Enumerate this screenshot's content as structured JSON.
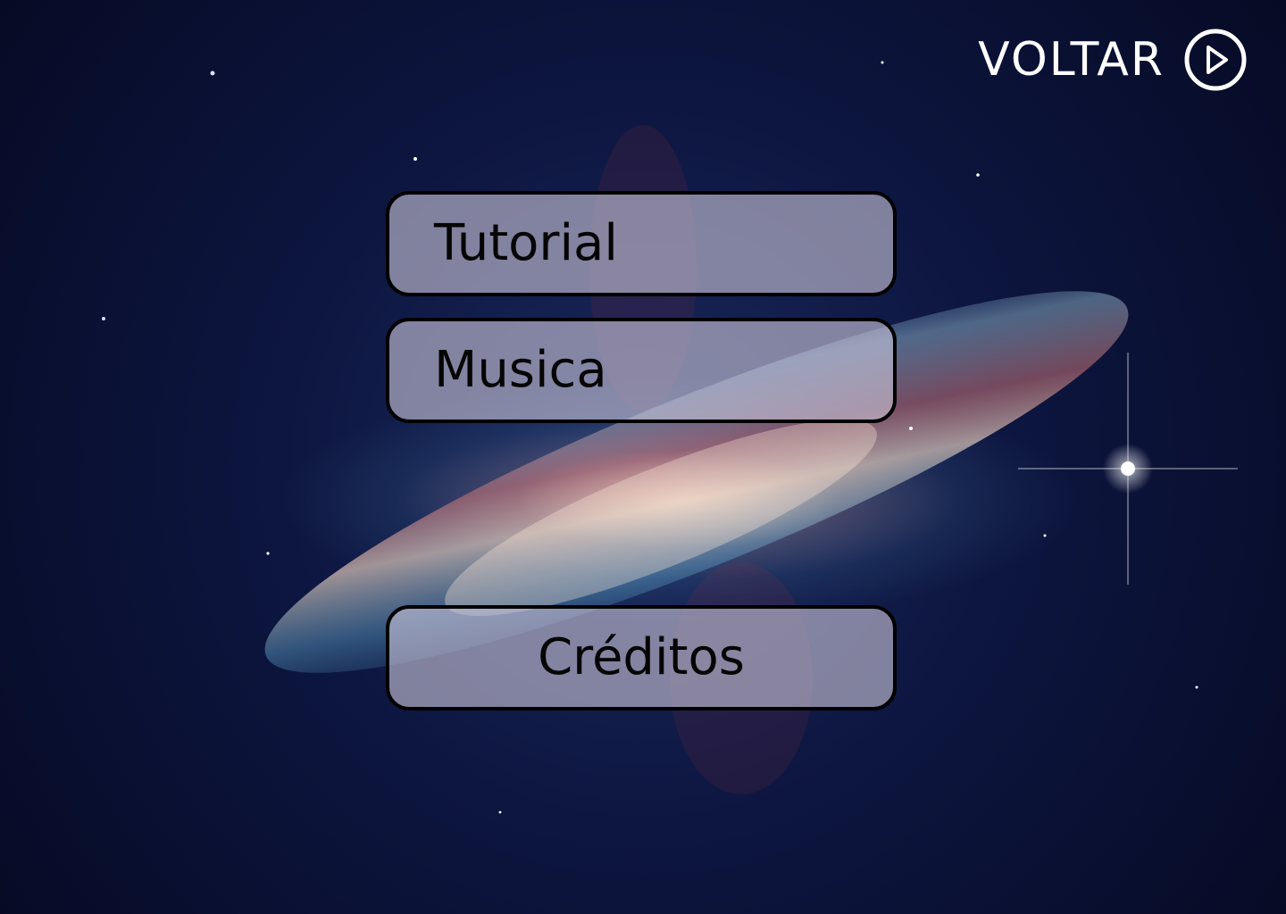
{
  "header": {
    "back_label": "VOLTAR",
    "back_icon": "play-circle-icon"
  },
  "menu": {
    "items": [
      {
        "label": "Tutorial"
      },
      {
        "label": "Musica"
      },
      {
        "label": "Créditos"
      }
    ]
  },
  "colors": {
    "background": "#070b26",
    "button_fill": "#c8c3d7",
    "button_border": "#000000",
    "header_text": "#ffffff"
  }
}
